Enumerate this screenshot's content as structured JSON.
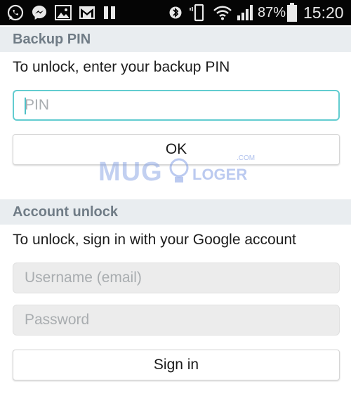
{
  "status_bar": {
    "battery_percent": "87%",
    "time": "15:20",
    "icons": [
      "whatsapp-icon",
      "messenger-icon",
      "gallery-icon",
      "gmail-icon",
      "pause-icon",
      "bluetooth-icon",
      "vibrate-icon",
      "wifi-icon",
      "signal-icon",
      "battery-icon"
    ]
  },
  "backup_pin": {
    "header": "Backup PIN",
    "instruction": "To unlock, enter your backup PIN",
    "pin_placeholder": "PIN",
    "ok_label": "OK"
  },
  "watermark": {
    "left": "MUG",
    "right": "LOGER",
    "suffix": ".COM"
  },
  "account_unlock": {
    "header": "Account unlock",
    "instruction": "To unlock, sign in with your Google account",
    "username_placeholder": "Username (email)",
    "password_placeholder": "Password",
    "sign_in_label": "Sign in"
  },
  "colors": {
    "status_bar_bg": "#050505",
    "section_header_bg": "#e9edf0",
    "section_header_text": "#707c86",
    "focus_accent": "#62ccd0",
    "disabled_field_bg": "#ececec"
  }
}
